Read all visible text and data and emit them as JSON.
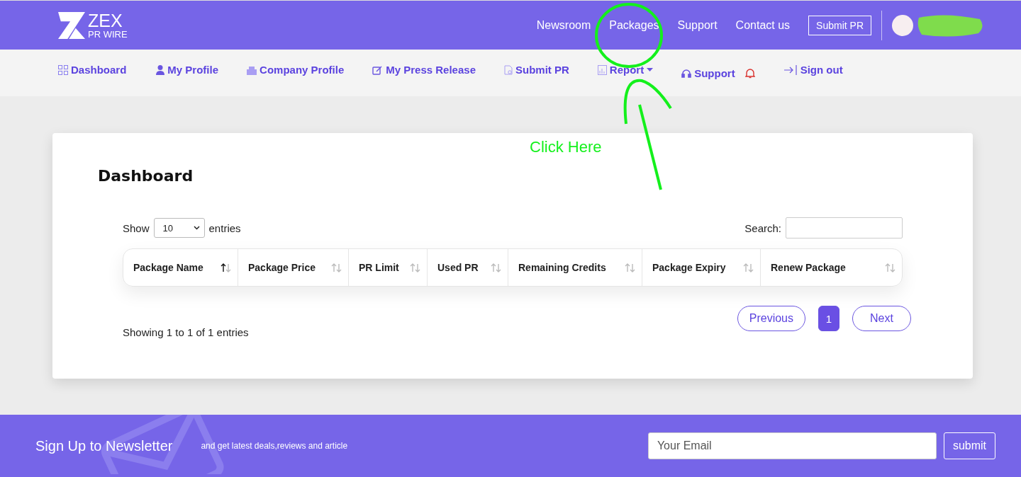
{
  "header": {
    "logo": {
      "mark": "ZEX",
      "sub": "PR WIRE"
    },
    "links": [
      "Newsroom",
      "Packages",
      "Support",
      "Contact us"
    ],
    "button": "Submit PR"
  },
  "subnav": [
    {
      "label": "Dashboard",
      "kind": "grid",
      "dropdown": false,
      "alert": false
    },
    {
      "label": "My Profile",
      "kind": "user",
      "dropdown": false,
      "alert": false
    },
    {
      "label": "Company Profile",
      "kind": "building",
      "dropdown": false,
      "alert": false
    },
    {
      "label": "My Press Release",
      "kind": "edit",
      "dropdown": false,
      "alert": false
    },
    {
      "label": "Submit PR",
      "kind": "file",
      "dropdown": false,
      "alert": false
    },
    {
      "label": "Report",
      "kind": "chart",
      "dropdown": true,
      "alert": false
    },
    {
      "label": "Support",
      "kind": "headset",
      "dropdown": false,
      "alert": true
    },
    {
      "label": "Sign out",
      "kind": "signout",
      "dropdown": false,
      "alert": false
    }
  ],
  "annotation": {
    "text": "Click Here"
  },
  "card": {
    "title": "Dashboard",
    "show_label": "Show",
    "page_size": "10",
    "entries_label": "entries",
    "search_label": "Search:",
    "columns": [
      {
        "label": "Package Name",
        "sorted": true
      },
      {
        "label": "Package Price",
        "sorted": false
      },
      {
        "label": "PR Limit",
        "sorted": false
      },
      {
        "label": "Used PR",
        "sorted": false
      },
      {
        "label": "Remaining Credits",
        "sorted": false
      },
      {
        "label": "Package Expiry",
        "sorted": false
      },
      {
        "label": "Renew Package",
        "sorted": false
      }
    ],
    "info": "Showing 1 to 1 of 1 entries",
    "previous": "Previous",
    "pages": [
      {
        "label": "1",
        "selected": true
      }
    ],
    "next": "Next"
  },
  "footer": {
    "title": "Sign Up to Newsletter",
    "text": "and get latest deals,reviews and article",
    "placeholder": "Your Email",
    "button": "submit"
  }
}
